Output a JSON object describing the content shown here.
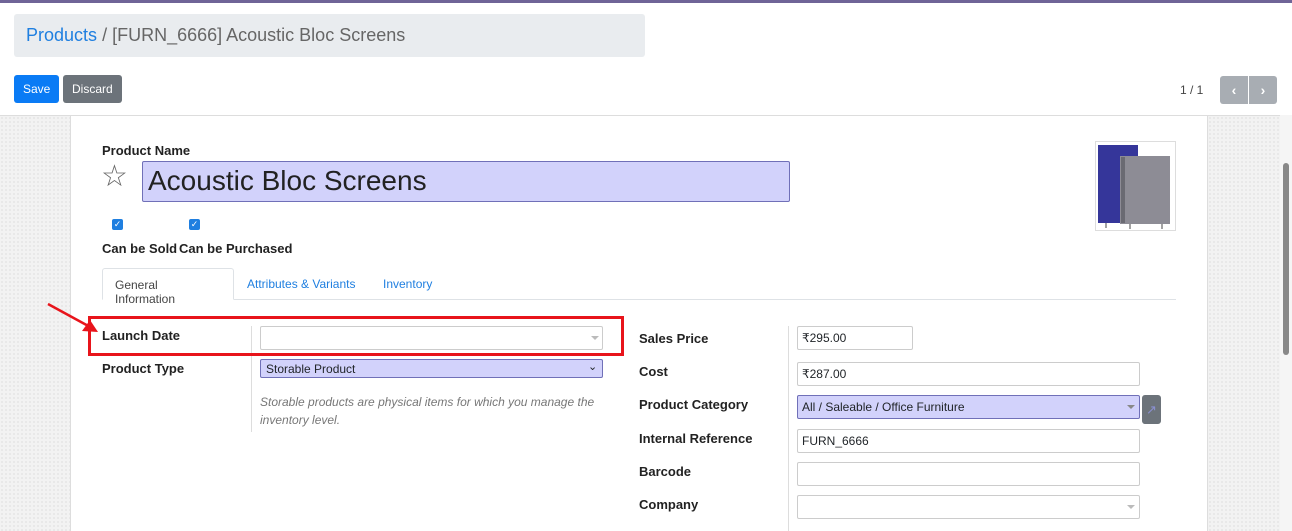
{
  "breadcrumb": {
    "parent": "Products",
    "separator": "/",
    "current": "[FURN_6666] Acoustic Bloc Screens"
  },
  "toolbar": {
    "save_label": "Save",
    "discard_label": "Discard"
  },
  "pager": {
    "value": "1 / 1",
    "prev_icon": "chevron-left-icon",
    "next_icon": "chevron-right-icon"
  },
  "form": {
    "product_name_label": "Product Name",
    "product_name": "Acoustic Bloc Screens",
    "favorite_icon": "star-outline-icon",
    "can_be_sold": {
      "label": "Can be Sold",
      "checked": true
    },
    "can_be_purchased": {
      "label": "Can be Purchased",
      "checked": true
    },
    "tabs": [
      {
        "label": "General Information",
        "active": true
      },
      {
        "label": "Attributes & Variants",
        "active": false
      },
      {
        "label": "Inventory",
        "active": false
      }
    ],
    "left": {
      "launch_date": {
        "label": "Launch Date",
        "value": ""
      },
      "product_type": {
        "label": "Product Type",
        "value": "Storable Product",
        "help": "Storable products are physical items for which you manage the inventory level."
      }
    },
    "right": {
      "sales_price": {
        "label": "Sales Price",
        "value": "₹295.00"
      },
      "cost": {
        "label": "Cost",
        "value": "₹287.00"
      },
      "product_category": {
        "label": "Product Category",
        "value": "All / Saleable / Office Furniture"
      },
      "internal_reference": {
        "label": "Internal Reference",
        "value": "FURN_6666"
      },
      "barcode": {
        "label": "Barcode",
        "value": ""
      },
      "company": {
        "label": "Company",
        "value": ""
      }
    }
  },
  "annotation": {
    "highlight_color": "#e8141b"
  }
}
